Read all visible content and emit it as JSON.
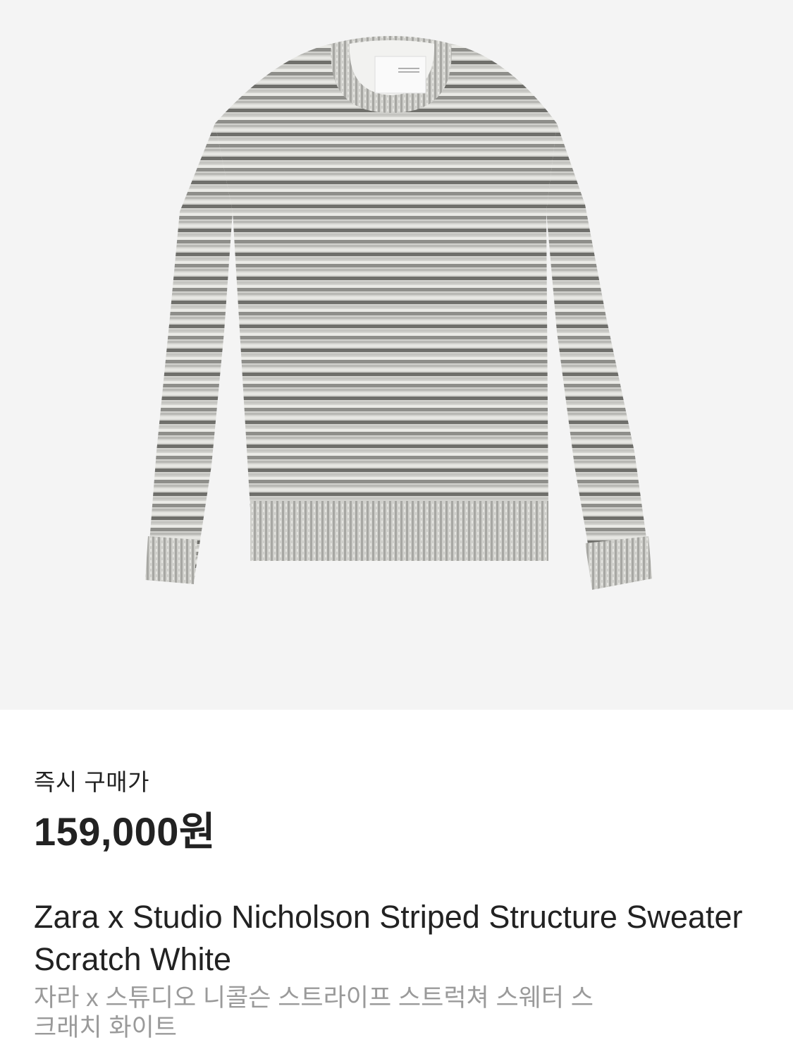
{
  "product": {
    "image_icon": "sweater-image",
    "price_label": "즉시 구매가",
    "price": "159,000원",
    "name_en": "Zara x Studio Nicholson Striped Structure Sweater Scratch White",
    "name_ko": "자라 x 스튜디오 니콜슨 스트라이프 스트럭쳐 스웨터 스크래치 화이트"
  },
  "colors": {
    "image_bg": "#f4f4f4",
    "text_primary": "#222222",
    "text_secondary": "#9a9a9a"
  }
}
